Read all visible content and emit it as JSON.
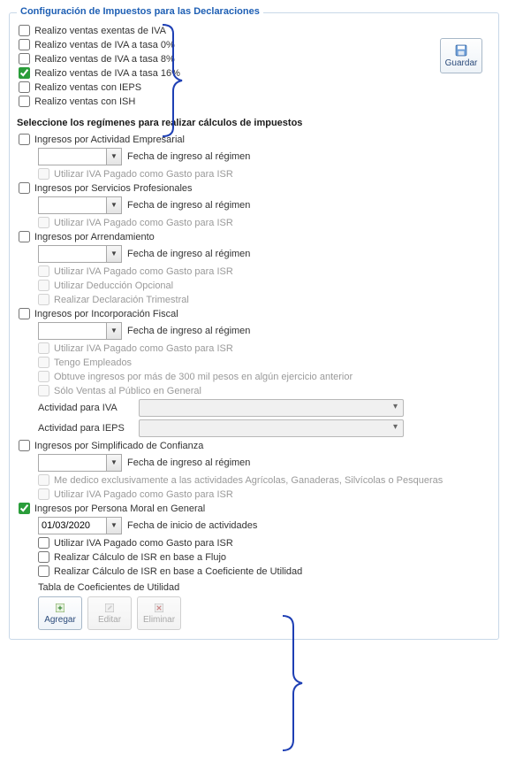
{
  "group_title": "Configuración de Impuestos para las Declaraciones",
  "save_button_label": "Guardar",
  "sales_checks": [
    {
      "label": "Realizo ventas exentas de IVA",
      "checked": false
    },
    {
      "label": "Realizo ventas de IVA a tasa 0%",
      "checked": false
    },
    {
      "label": "Realizo ventas de IVA a tasa 8%",
      "checked": false
    },
    {
      "label": "Realizo ventas de IVA a tasa 16%",
      "checked": true
    },
    {
      "label": "Realizo ventas con IEPS",
      "checked": false
    },
    {
      "label": "Realizo ventas con ISH",
      "checked": false
    }
  ],
  "regimen_heading": "Seleccione los regímenes para realizar cálculos de impuestos",
  "date_label": "Fecha de ingreso al régimen",
  "iva_gasto_label": "Utilizar IVA Pagado como Gasto para ISR",
  "regimen_empresarial": {
    "title": "Ingresos por Actividad Empresarial",
    "checked": false,
    "date_value": ""
  },
  "regimen_profesionales": {
    "title": "Ingresos por Servicios Profesionales",
    "checked": false,
    "date_value": ""
  },
  "regimen_arrendamiento": {
    "title": "Ingresos por Arrendamiento",
    "checked": false,
    "date_value": "",
    "deduccion_label": "Utilizar Deducción Opcional",
    "trimestral_label": "Realizar Declaración Trimestral"
  },
  "regimen_incorporacion": {
    "title": "Ingresos por Incorporación Fiscal",
    "checked": false,
    "date_value": "",
    "empleados_label": "Tengo Empleados",
    "ingresos300_label": "Obtuve ingresos por más de 300 mil pesos en algún ejercicio anterior",
    "solo_publico_label": "Sólo Ventas al Público en General",
    "actividad_iva_label": "Actividad para IVA",
    "actividad_ieps_label": "Actividad para IEPS"
  },
  "regimen_confianza": {
    "title": "Ingresos por Simplificado de Confianza",
    "checked": false,
    "date_value": "",
    "agropecuarias_label": "Me dedico exclusivamente a las actividades Agrícolas, Ganaderas, Silvícolas o Pesqueras"
  },
  "regimen_moral": {
    "title": "Ingresos por Persona Moral en General",
    "checked": true,
    "date_value": "01/03/2020",
    "date_label": "Fecha de inicio de actividades",
    "flujo_label": "Realizar Cálculo de ISR en base a Flujo",
    "coef_label": "Realizar Cálculo de ISR en base a Coeficiente de Utilidad",
    "tabla_label": "Tabla de Coeficientes de Utilidad"
  },
  "toolbar": {
    "agregar": "Agregar",
    "editar": "Editar",
    "eliminar": "Eliminar"
  }
}
